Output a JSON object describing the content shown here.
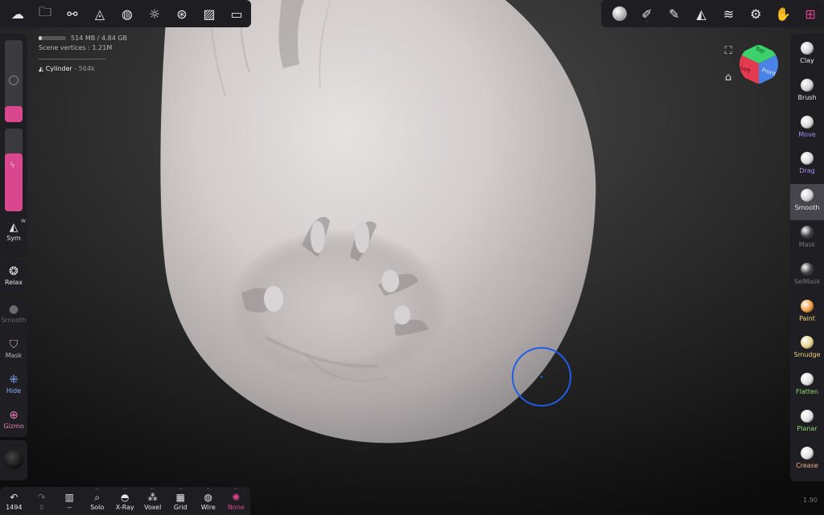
{
  "toolbar_top_left": [
    {
      "name": "menu-icon"
    },
    {
      "name": "folder-icon"
    },
    {
      "name": "scene-graph-icon"
    },
    {
      "name": "topology-icon"
    },
    {
      "name": "material-icon"
    },
    {
      "name": "light-icon"
    },
    {
      "name": "camera-lens-icon"
    },
    {
      "name": "image-icon"
    },
    {
      "name": "video-icon"
    }
  ],
  "toolbar_top_right": [
    {
      "name": "active-brush-icon"
    },
    {
      "name": "stroke-icon"
    },
    {
      "name": "picker-icon"
    },
    {
      "name": "symmetry-icon"
    },
    {
      "name": "layers-icon"
    },
    {
      "name": "settings-icon"
    },
    {
      "name": "gesture-icon"
    },
    {
      "name": "shortcut-icon"
    }
  ],
  "stats": {
    "memory": "514 MB / 4.84 GB",
    "memory_fraction": 0.1,
    "vertices": "Scene vertices : 1.21M",
    "object_name": "Cylinder",
    "object_count": "- 564k"
  },
  "left_panel": {
    "radius_fraction": 0.25,
    "intensity_fraction": 0.7,
    "sym_label": "Sym",
    "sym_badge": "W",
    "relax_label": "Relax",
    "smooth_label": "Smooth",
    "mask_label": "Mask",
    "hide_label": "Hide",
    "gizmo_label": "Gizmo"
  },
  "tools": [
    {
      "label": "Clay",
      "color": "#e6e6e6",
      "ball": "#cfcfcf"
    },
    {
      "label": "Brush",
      "color": "#e6e6e6",
      "ball": "#cfcfcf"
    },
    {
      "label": "Move",
      "color": "#a98cf0",
      "ball": "#d8d8d8"
    },
    {
      "label": "Drag",
      "color": "#a98cf0",
      "ball": "#d8d8d8"
    },
    {
      "label": "Smooth",
      "color": "#e6e6e6",
      "ball": "#d0d0d0"
    },
    {
      "label": "Mask",
      "color": "#777777",
      "ball": "#3a3a3a"
    },
    {
      "label": "SelMask",
      "color": "#777777",
      "ball": "#3a3a3a"
    },
    {
      "label": "Paint",
      "color": "#f0d278",
      "ball": "#f29a3b"
    },
    {
      "label": "Smudge",
      "color": "#f0d278",
      "ball": "#e8d28a"
    },
    {
      "label": "Flatten",
      "color": "#8fd86e",
      "ball": "#e0e0e0"
    },
    {
      "label": "Planar",
      "color": "#8fd86e",
      "ball": "#e0e0e0"
    },
    {
      "label": "Crease",
      "color": "#f0b080",
      "ball": "#e0e0e0"
    }
  ],
  "bottom_bar": [
    {
      "label": "1494",
      "name": "undo-button",
      "icon": "undo-icon",
      "glyph": "↶"
    },
    {
      "label": "0",
      "name": "redo-button",
      "icon": "redo-icon",
      "glyph": "↷"
    },
    {
      "label": "--",
      "name": "scene-history-button",
      "icon": "book-icon",
      "glyph": "▥"
    },
    {
      "label": "Solo",
      "name": "solo-button",
      "icon": "search-icon",
      "glyph": "⌕"
    },
    {
      "label": "X-Ray",
      "name": "xray-button",
      "icon": "glasses-icon",
      "glyph": "◓"
    },
    {
      "label": "Voxel",
      "name": "voxel-button",
      "icon": "voxel-icon",
      "glyph": "⁂"
    },
    {
      "label": "Grid",
      "name": "grid-button",
      "icon": "grid-icon",
      "glyph": "▦"
    },
    {
      "label": "Wire",
      "name": "wire-button",
      "icon": "wire-icon",
      "glyph": "◍"
    },
    {
      "label": "None",
      "name": "none-button",
      "icon": "none-icon",
      "glyph": "✺"
    }
  ],
  "cube": {
    "top": "Top",
    "front": "Front",
    "right": "Left"
  },
  "version": "1.90"
}
